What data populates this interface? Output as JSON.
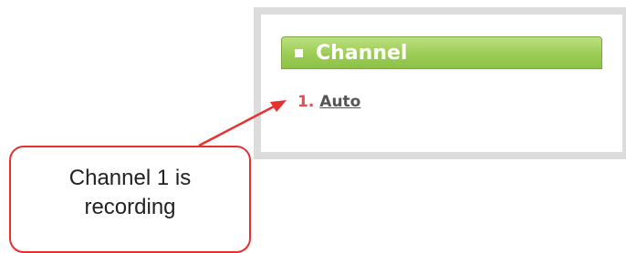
{
  "panel": {
    "header_title": "Channel",
    "channels": [
      {
        "number": "1.",
        "name": "Auto"
      }
    ]
  },
  "callout": {
    "text": "Channel 1 is recording"
  },
  "colors": {
    "header_green": "#9ccc55",
    "list_number": "#e05050",
    "callout_border": "#e8312f"
  }
}
